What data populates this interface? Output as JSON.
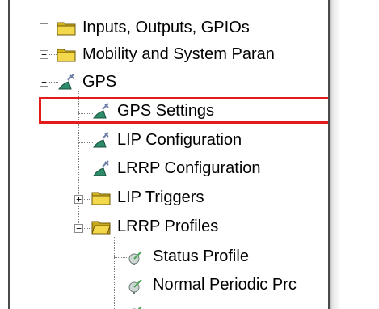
{
  "tree": {
    "items": [
      {
        "label": "Inputs, Outputs, GPIOs",
        "icon": "folder-icon",
        "expander": "+"
      },
      {
        "label": "Mobility and System Paran",
        "icon": "folder-icon",
        "expander": "+"
      },
      {
        "label": "GPS",
        "icon": "satellite-icon",
        "expander": "−"
      },
      {
        "label": "GPS Settings",
        "icon": "satellite-icon"
      },
      {
        "label": "LIP Configuration",
        "icon": "satellite-icon"
      },
      {
        "label": "LRRP Configuration",
        "icon": "satellite-icon"
      },
      {
        "label": "LIP Triggers",
        "icon": "folder-icon",
        "expander": "+"
      },
      {
        "label": "LRRP Profiles",
        "icon": "folder-open-icon",
        "expander": "−"
      },
      {
        "label": "Status Profile",
        "icon": "antenna-icon"
      },
      {
        "label": "Normal Periodic Prc",
        "icon": "antenna-icon"
      }
    ],
    "highlight_color": "#e21b1b"
  }
}
